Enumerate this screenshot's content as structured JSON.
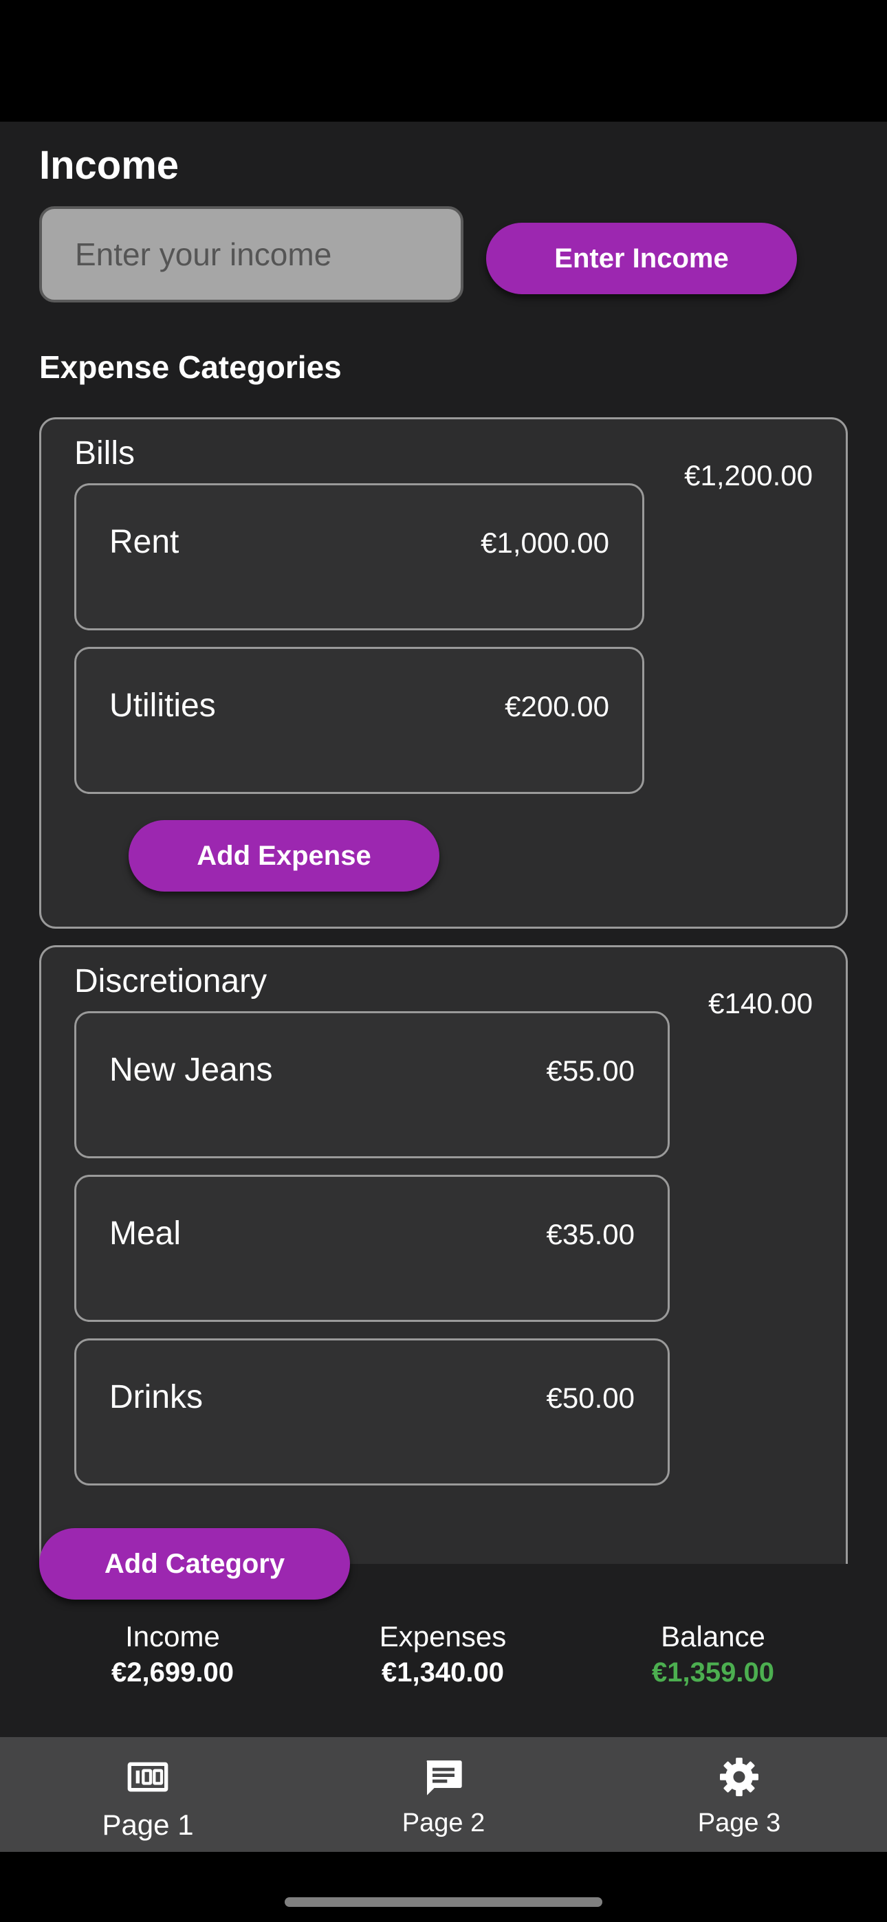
{
  "income": {
    "title": "Income",
    "input_placeholder": "Enter your income",
    "input_value": "",
    "button_label": "Enter Income"
  },
  "categories": {
    "title": "Expense Categories",
    "bills": {
      "name": "Bills",
      "total": "€1,200.00",
      "items": [
        {
          "name": "Rent",
          "amount": "€1,000.00"
        },
        {
          "name": "Utilities",
          "amount": "€200.00"
        }
      ],
      "add_expense_label": "Add Expense"
    },
    "discretionary": {
      "name": "Discretionary",
      "total": "€140.00",
      "items": [
        {
          "name": "New Jeans",
          "amount": "€55.00"
        },
        {
          "name": "Meal",
          "amount": "€35.00"
        },
        {
          "name": "Drinks",
          "amount": "€50.00"
        }
      ]
    },
    "add_category_label": "Add Category"
  },
  "summary": {
    "income_label": "Income",
    "income_value": "€2,699.00",
    "expenses_label": "Expenses",
    "expenses_value": "€1,340.00",
    "balance_label": "Balance",
    "balance_value": "€1,359.00",
    "balance_color": "#4caf50"
  },
  "nav": [
    {
      "label": "Page 1",
      "icon": "money-icon"
    },
    {
      "label": "Page 2",
      "icon": "chat-icon"
    },
    {
      "label": "Page 3",
      "icon": "gear-icon"
    }
  ],
  "colors": {
    "accent": "#9c27b0",
    "background": "#1e1e1f",
    "card": "#2d2d2e",
    "nav_background": "#454546"
  }
}
